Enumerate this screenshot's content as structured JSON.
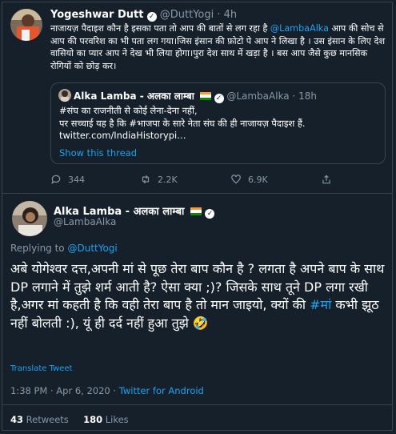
{
  "top_tweet": {
    "display_name": "Yogeshwar Dutt",
    "handle": "@DuttYogi",
    "dot": "·",
    "time": "4h",
    "body_text_1": "नाजायज़ पैदाइश कौन है इसका पता तो आप की बातों से लग रहा है ",
    "mention": "@LambaAlka",
    "body_text_2": " आप की सोच से आप की परवरिश का भी पता लग गया।जिस इंसान की फ़ोटो पे आप ने लिखा है । उस इंसान के लिए देश वासियो का प्यार आप ने देख भी लिया होगा।पुरा देश साथ में खड़ा है । बस आप जैसे कुछ मानसिक रोगियों को छोड़ कर।",
    "quoted": {
      "display_name": "Alka Lamba - अलका लाम्बा",
      "handle": "@LambaAlka",
      "dot": "·",
      "time": "18h",
      "line_1": "#संघ का राजनीती से कोई लेना-देना नहीं,",
      "line_2": "पर सच्चाई यह है कि #भाजपा के सारे नेता संघ की ही नाजायज़ पैदाइश हैं.",
      "line_3": "twitter.com/IndiaHistorypi…",
      "show_thread": "Show this thread"
    },
    "actions": {
      "replies": "344",
      "retweets": "2.2K",
      "likes": "6.9K"
    }
  },
  "main_tweet": {
    "display_name": "Alka Lamba - अलका लाम्बा",
    "handle": "@LambaAlka",
    "replying_label": "Replying to ",
    "replying_handle": "@DuttYogi",
    "body_text_1": "अबे योगेश्वर दत्त,अपनी मां से पूछ तेरा बाप कौन है ? लगता है अपने बाप के साथ DP लगाने में तुझे शर्म आती है? ऐसा क्या ;)? जिसके साथ तूने DP लगा रखी है,अगर मां कहती है कि वही तेरा बाप है तो मान जाइयो, क्यों की ",
    "hashtag": "#मां",
    "body_text_2": " कभी झूठ नहीं बोलती :), यूं ही दर्द नहीं हुआ तुझे ",
    "emoji": "🤣",
    "translate_label": "Translate Tweet",
    "timestamp": "1:38 PM · Apr 6, 2020",
    "meta_dot": " · ",
    "client": "Twitter for Android",
    "retweet_count": "43",
    "retweet_label": " Retweets",
    "like_count": "180",
    "like_label": " Likes"
  },
  "colors": {
    "background": "#15202b",
    "accent": "#1da1f2",
    "secondary_text": "#8899a6",
    "border": "#38444d"
  },
  "icons": [
    "verified-badge-icon",
    "india-flag-icon",
    "reply-icon",
    "retweet-icon",
    "like-icon",
    "share-icon"
  ]
}
